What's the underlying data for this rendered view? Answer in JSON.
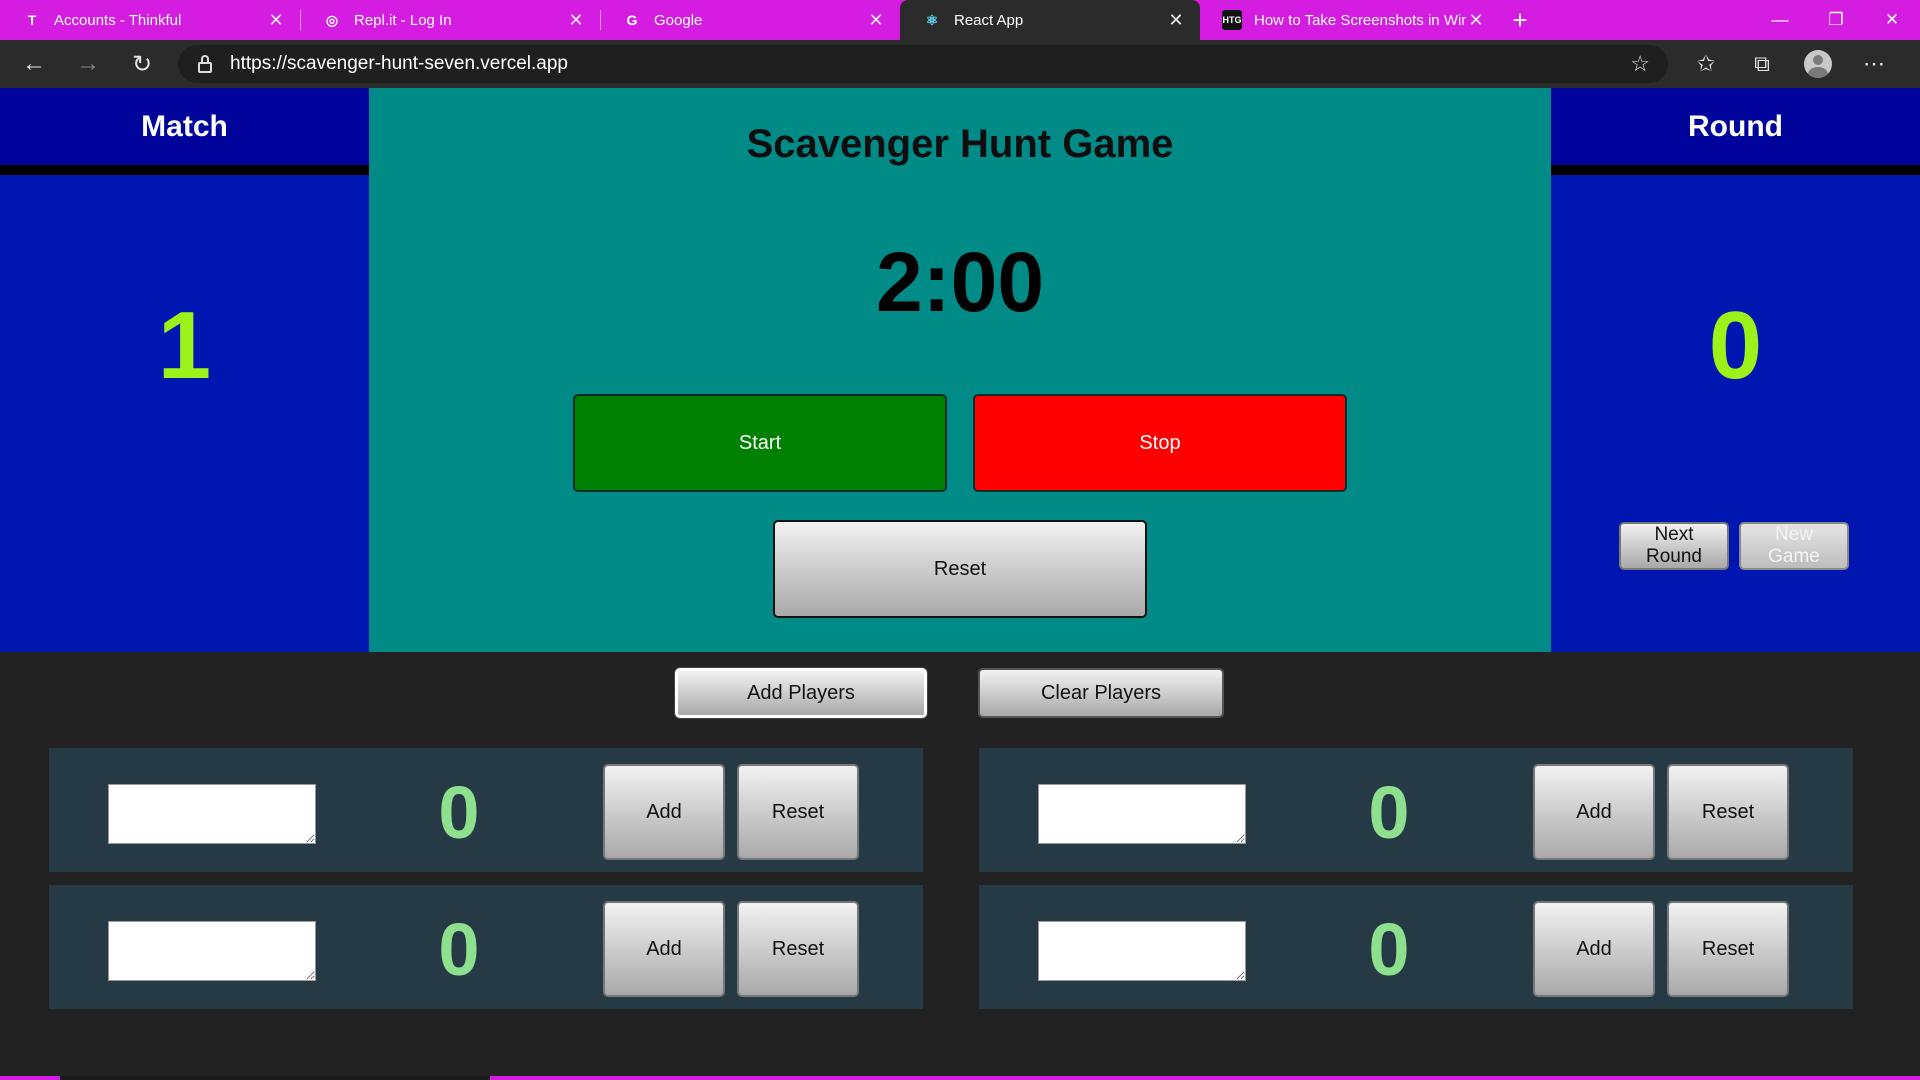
{
  "browser": {
    "tabs": [
      {
        "title": "Accounts - Thinkful",
        "favicon": "thinkful-icon",
        "active": false
      },
      {
        "title": "Repl.it - Log In",
        "favicon": "replit-icon",
        "active": false
      },
      {
        "title": "Google",
        "favicon": "google-icon",
        "active": false
      },
      {
        "title": "React App",
        "favicon": "react-icon",
        "active": true
      },
      {
        "title": "How to Take Screenshots in Win",
        "favicon": "htg-icon",
        "active": false
      }
    ],
    "favicon_text": {
      "thinkful": "T",
      "replit": "◎",
      "google": "G",
      "react": "⚛",
      "htg": "HTG"
    },
    "url": "https://scavenger-hunt-seven.vercel.app",
    "colors": {
      "tabbar": "#d41de0",
      "toolbar": "#2b2b2b"
    }
  },
  "match": {
    "label": "Match",
    "value": "1"
  },
  "round": {
    "label": "Round",
    "value": "0",
    "next_label": "Next Round",
    "new_game_label": "New Game"
  },
  "game": {
    "title": "Scavenger Hunt Game",
    "timer": "2:00",
    "start_label": "Start",
    "stop_label": "Stop",
    "reset_label": "Reset"
  },
  "players_controls": {
    "add_label": "Add Players",
    "clear_label": "Clear Players"
  },
  "players": [
    {
      "name": "",
      "score": "0",
      "add_label": "Add",
      "reset_label": "Reset"
    },
    {
      "name": "",
      "score": "0",
      "add_label": "Add",
      "reset_label": "Reset"
    },
    {
      "name": "",
      "score": "0",
      "add_label": "Add",
      "reset_label": "Reset"
    },
    {
      "name": "",
      "score": "0",
      "add_label": "Add",
      "reset_label": "Reset"
    }
  ],
  "colors": {
    "side_panel": "#0016b0",
    "side_header": "#00049a",
    "center_panel": "#008b87",
    "score_highlight": "#9df21a",
    "player_score": "#8ee08e",
    "start": "#008000",
    "stop": "#ff0000",
    "player_card": "#263a45"
  }
}
